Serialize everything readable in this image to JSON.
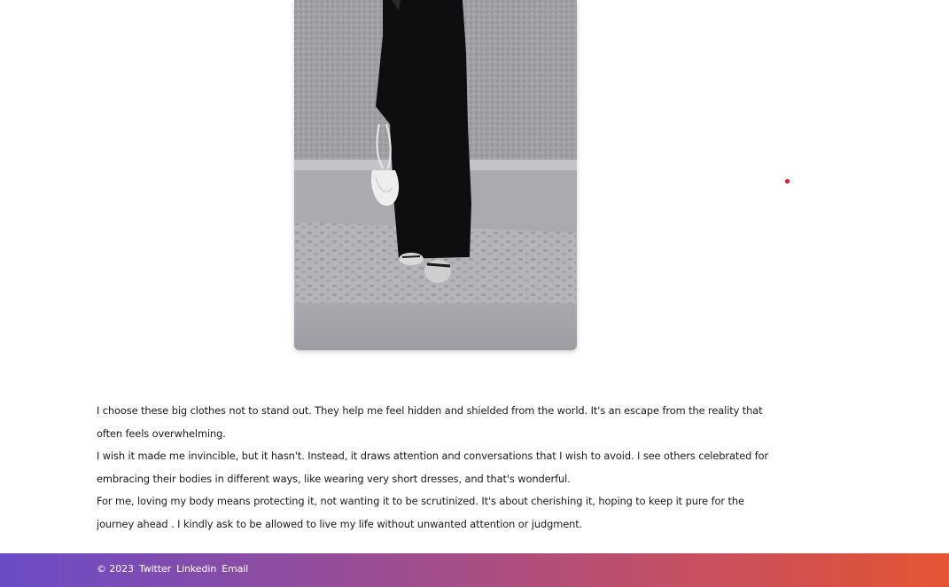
{
  "article": {
    "paragraphs": [
      "I choose these big clothes not to stand out. They help me feel hidden and shielded from the world. It's an escape from the reality that often feels overwhelming.",
      "I wish it made me invincible, but it hasn't. Instead, it draws attention and conversations that I wish to avoid. I see others celebrated for embracing their bodies in different ways, like wearing very short dresses, and that's wonderful.",
      "For me, loving my body means protecting it, not wanting it to be scrutinized. It's about cherishing it, hoping to keep it pure for the journey ahead . I kindly ask to be allowed to live my life without unwanted attention or judgment."
    ]
  },
  "footer": {
    "copyright": "© 2023",
    "links": [
      "Twitter",
      "Linkedin",
      "Email"
    ],
    "gradient_start": "#6a4cc8",
    "gradient_end": "#e45431"
  },
  "accent": {
    "dot_color": "#e3132c"
  }
}
